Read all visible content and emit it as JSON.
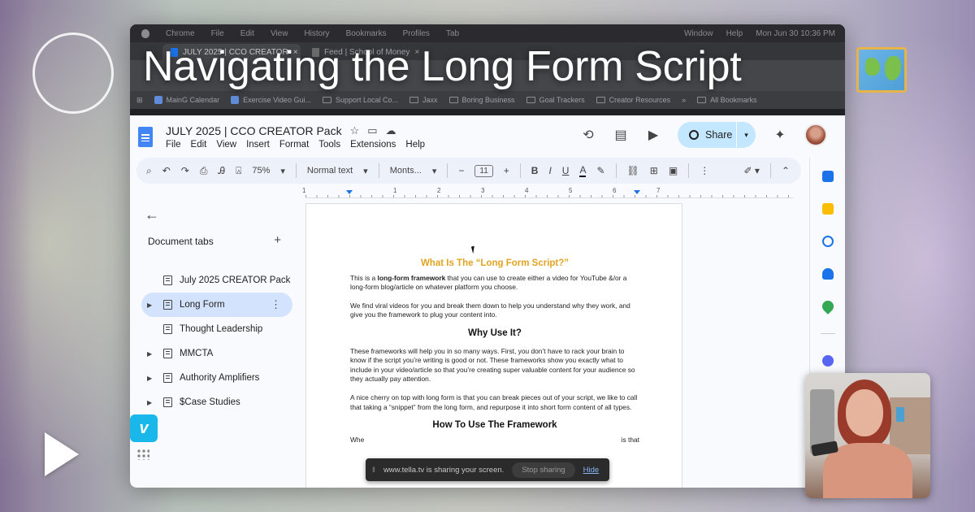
{
  "overlay": {
    "title": "Navigating the Long Form Script"
  },
  "mac_menubar": {
    "items": [
      "Chrome",
      "File",
      "Edit",
      "View",
      "History",
      "Bookmarks",
      "Profiles",
      "Tab"
    ],
    "right_items": [
      "Window",
      "Help"
    ],
    "datetime": "Mon Jun 30  10:36 PM"
  },
  "browser": {
    "tabs": [
      {
        "label": "JULY 2025 | CCO CREATOR",
        "active": true
      },
      {
        "label": "Feed | School of Money",
        "active": false
      }
    ],
    "bookmarks": [
      {
        "label": "MainG Calendar",
        "type": "site"
      },
      {
        "label": "Exercise Video Gui...",
        "type": "site"
      },
      {
        "label": "Support Local Co...",
        "type": "folder"
      },
      {
        "label": "Jaxx",
        "type": "folder"
      },
      {
        "label": "Boring Business",
        "type": "folder"
      },
      {
        "label": "Goal Trackers",
        "type": "folder"
      },
      {
        "label": "Creator Resources",
        "type": "folder"
      },
      {
        "label": "All Bookmarks",
        "type": "folder"
      }
    ]
  },
  "docs": {
    "title": "JULY 2025 | CCO CREATOR Pack",
    "menu": [
      "File",
      "Edit",
      "View",
      "Insert",
      "Format",
      "Tools",
      "Extensions",
      "Help"
    ],
    "share_label": "Share",
    "toolbar": {
      "zoom": "75%",
      "style": "Normal text",
      "font": "Monts...",
      "font_size": "11",
      "bold": "B",
      "italic": "I",
      "underline": "U",
      "text_color": "A"
    },
    "ruler_numbers": [
      "1",
      "1",
      "2",
      "3",
      "4",
      "5",
      "6",
      "7"
    ],
    "sidebar": {
      "heading": "Document tabs",
      "tabs": [
        {
          "label": "July 2025 CREATOR Pack",
          "expandable": false,
          "active": false
        },
        {
          "label": "Long Form",
          "expandable": true,
          "active": true
        },
        {
          "label": "Thought Leadership",
          "expandable": false,
          "active": false
        },
        {
          "label": "MMCTA",
          "expandable": true,
          "active": false
        },
        {
          "label": "Authority Amplifiers",
          "expandable": true,
          "active": false
        },
        {
          "label": "$Case Studies",
          "expandable": true,
          "active": false
        }
      ]
    },
    "page": {
      "heading1": "What Is The “Long Form Script?”",
      "p1_pre": "This is a ",
      "p1_bold": "long-form framework",
      "p1_post": " that you can use to create either a video for YouTube &/or a long-form blog/article on whatever platform you choose.",
      "p2": "We find viral videos for you and break them down to help you understand why they work, and give you the framework to plug your content into.",
      "heading2": "Why Use It?",
      "p3": "These frameworks will help you in so many ways. First, you don’t have to rack your brain to know if the script you’re writing is good or not. These frameworks show you exactly what to include in your video/article so that you’re creating super valuable content for your audience so they actually pay attention.",
      "p4": "A nice cherry on top with long form is that you can break pieces out of your script, we like to call that taking a “snippet” from the long form, and repurpose it into short form content of all types.",
      "heading3": "How To Use The Framework",
      "p5_start": "Whe",
      "p5_end": "is that"
    }
  },
  "sharing_bar": {
    "text": "www.tella.tv is sharing your screen.",
    "stop_label": "Stop sharing",
    "hide_label": "Hide"
  },
  "colors": {
    "share_button": "#c2e7ff",
    "active_tab": "#d3e3fd",
    "heading_gold": "#e0a422",
    "vimeo": "#1ab7ea"
  },
  "icons": [
    "play-icon",
    "map-emoji-icon",
    "vimeo-icon",
    "docs-logo-icon",
    "star-icon",
    "folder-move-icon",
    "cloud-icon",
    "history-icon",
    "comment-icon",
    "meet-icon",
    "gemini-icon"
  ]
}
